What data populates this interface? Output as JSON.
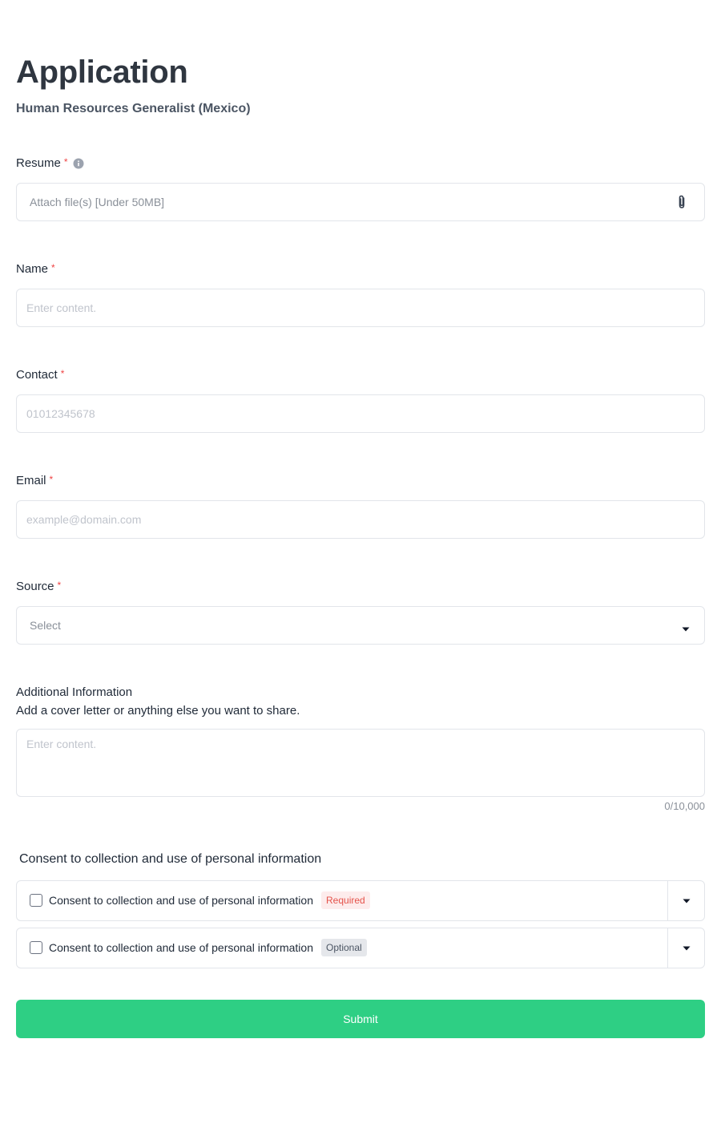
{
  "header": {
    "title": "Application",
    "subtitle": "Human Resources Generalist (Mexico)"
  },
  "required_mark": "*",
  "resume": {
    "label": "Resume",
    "info_icon": "info-circle-icon",
    "placeholder": "Attach file(s) [Under 50MB]",
    "attach_icon": "paperclip-icon"
  },
  "name": {
    "label": "Name",
    "placeholder": "Enter content."
  },
  "contact": {
    "label": "Contact",
    "placeholder": "01012345678"
  },
  "email": {
    "label": "Email",
    "placeholder": "example@domain.com"
  },
  "source": {
    "label": "Source",
    "selected": "Select",
    "caret_icon": "caret-down-icon"
  },
  "additional": {
    "label": "Additional Information",
    "help": "Add a cover letter or anything else you want to share.",
    "placeholder": "Enter content.",
    "counter": "0/10,000"
  },
  "consent": {
    "heading": "Consent to collection and use of personal information",
    "items": [
      {
        "label": "Consent to collection and use of personal information",
        "badge": "Required",
        "checked": false
      },
      {
        "label": "Consent to collection and use of personal information",
        "badge": "Optional",
        "checked": false
      }
    ]
  },
  "submit_label": "Submit",
  "colors": {
    "accent": "#2ecf84",
    "required": "#ef4444",
    "title": "#2f3640"
  }
}
